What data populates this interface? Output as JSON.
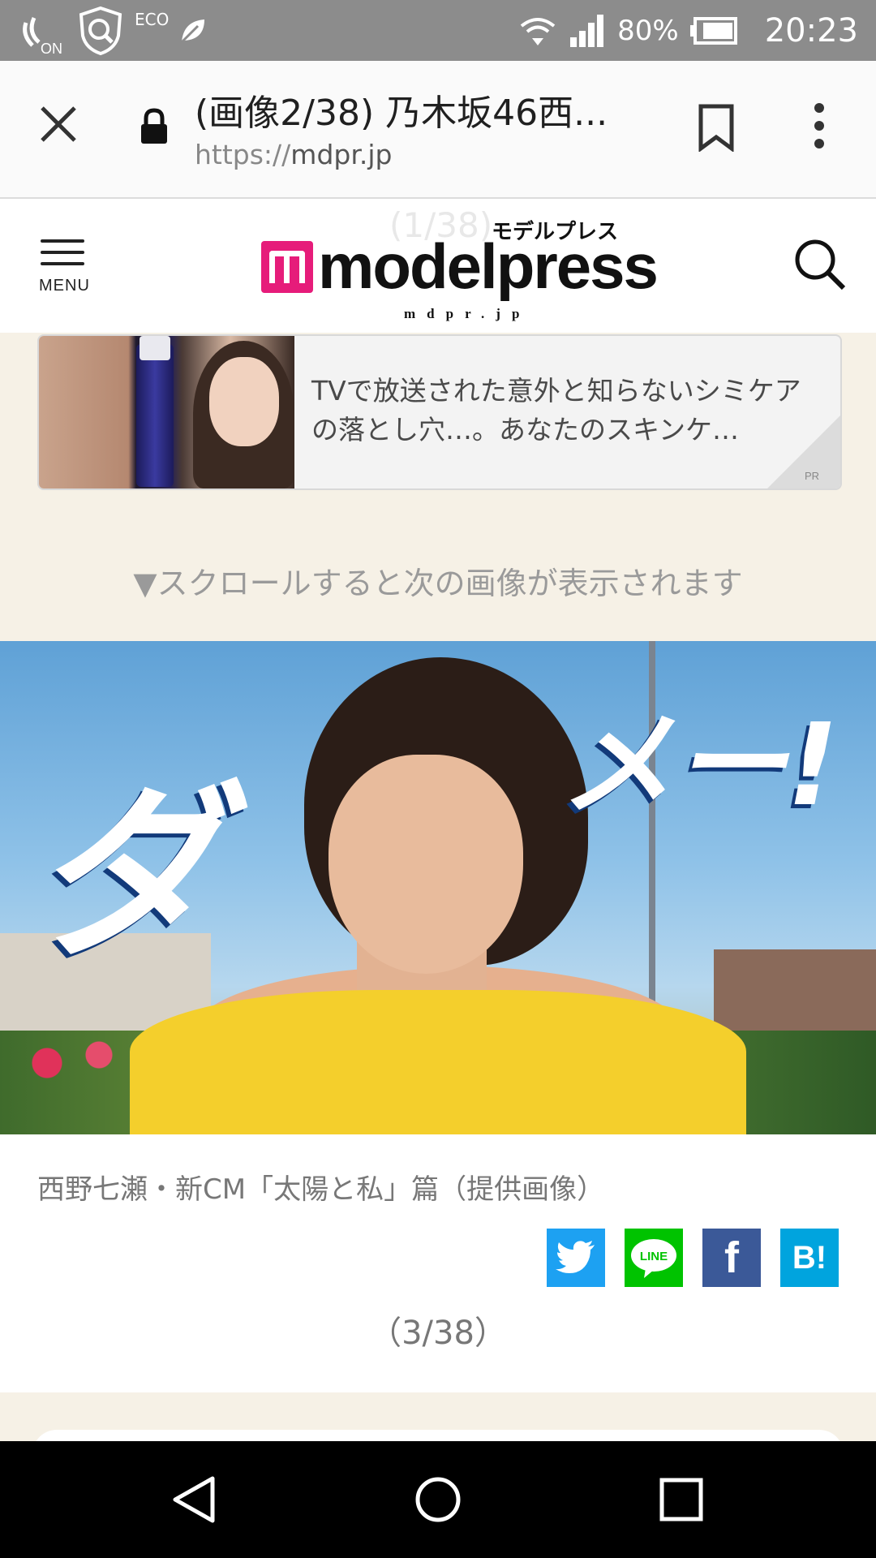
{
  "status_bar": {
    "battery_percent": "80%",
    "time": "20:23",
    "on_label": "ON",
    "eco_label": "ECO"
  },
  "browser": {
    "page_title": "(画像2/38) 乃木坂46西...",
    "url_scheme": "https://",
    "url_host": "mdpr.jp"
  },
  "site_header": {
    "menu_label": "MENU",
    "ghost_counter": "(1/38)",
    "logo_word": "modelpress",
    "logo_kana": "モデルプレス",
    "logo_domain": "mdpr.jp"
  },
  "ad": {
    "text": "TVで放送された意外と知らないシミケアの落とし穴…。あなたのスキンケ…",
    "badge": "PR"
  },
  "scroll_hint": "▼スクロールすると次の画像が表示されます",
  "main_image": {
    "overlay_left": "ダ",
    "overlay_right": "メー!"
  },
  "caption": "西野七瀬・新CM「太陽と私」篇（提供画像）",
  "share": {
    "twitter_icon": "twitter-bird-icon",
    "line_label": "LINE",
    "facebook_label": "f",
    "hatena_label": "B!"
  },
  "counter": "（3/38）",
  "colors": {
    "status_bar": "#8c8c8c",
    "brand_pink": "#e61c7a",
    "page_background": "#f6f1e6",
    "twitter": "#1da1f2",
    "line": "#00c300",
    "facebook": "#3b5998",
    "hatena": "#00a4de"
  }
}
